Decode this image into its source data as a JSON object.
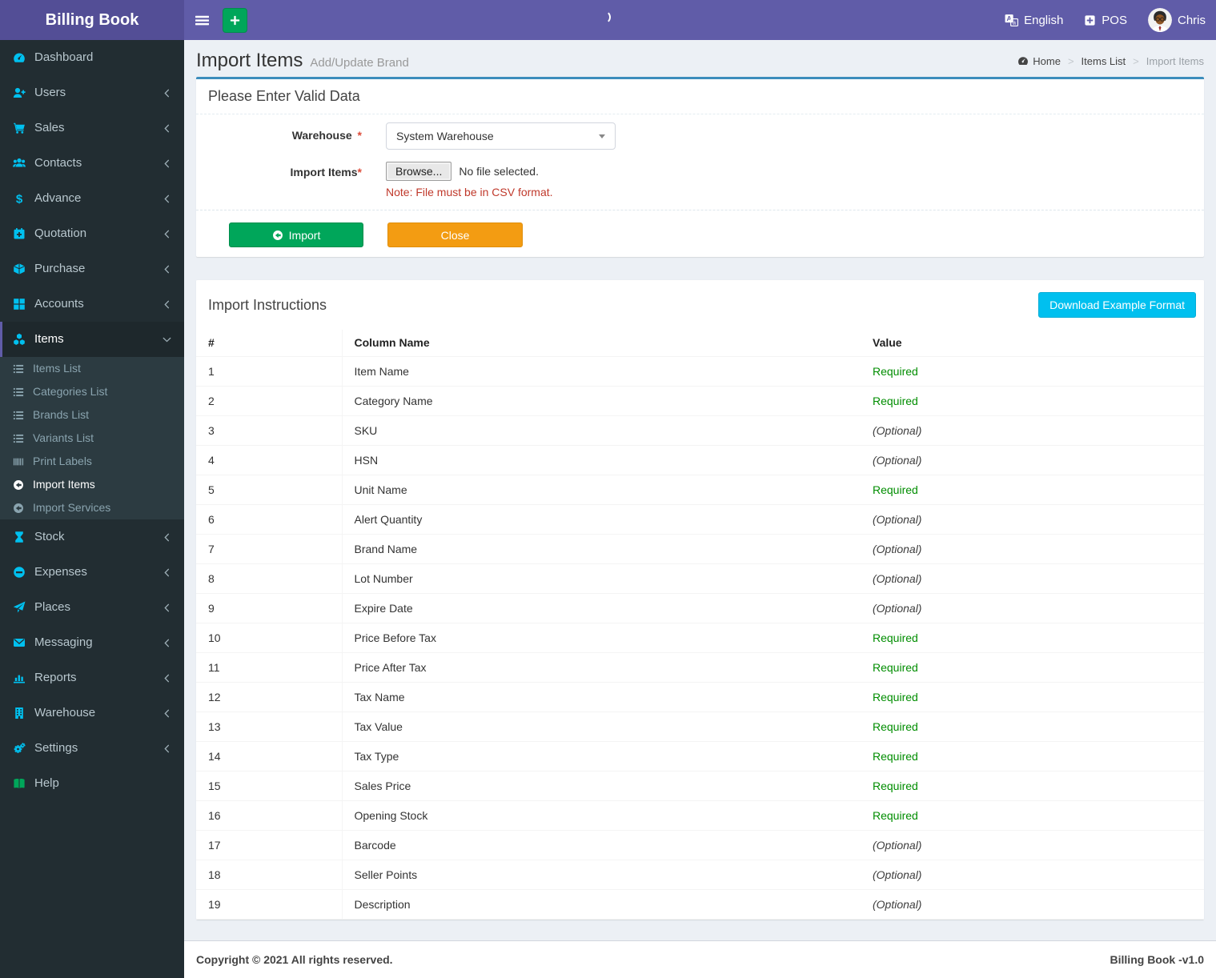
{
  "header": {
    "brand": "Billing Book",
    "language_label": "English",
    "pos_label": "POS",
    "user_name": "Chris"
  },
  "page": {
    "title": "Import Items",
    "subtitle": "Add/Update Brand"
  },
  "breadcrumb": {
    "items": [
      {
        "label": "Home",
        "icon": "gauge-icon",
        "current": false
      },
      {
        "label": "Items List",
        "icon": "",
        "current": false
      },
      {
        "label": "Import Items",
        "icon": "",
        "current": true
      }
    ]
  },
  "sidebar": {
    "items": [
      {
        "label": "Dashboard",
        "icon": "gauge-icon",
        "chevron": ""
      },
      {
        "label": "Users",
        "icon": "user-plus-icon",
        "chevron": "left"
      },
      {
        "label": "Sales",
        "icon": "cart-icon",
        "chevron": "left"
      },
      {
        "label": "Contacts",
        "icon": "users-icon",
        "chevron": "left"
      },
      {
        "label": "Advance",
        "icon": "dollar-icon",
        "chevron": "left"
      },
      {
        "label": "Quotation",
        "icon": "calendar-plus-icon",
        "chevron": "left"
      },
      {
        "label": "Purchase",
        "icon": "cube-icon",
        "chevron": "left"
      },
      {
        "label": "Accounts",
        "icon": "grid-icon",
        "chevron": "left"
      },
      {
        "label": "Items",
        "icon": "cubes-icon",
        "chevron": "down",
        "active": true,
        "submenu": [
          {
            "label": "Items List",
            "icon": "list-icon"
          },
          {
            "label": "Categories List",
            "icon": "list-icon"
          },
          {
            "label": "Brands List",
            "icon": "list-icon"
          },
          {
            "label": "Variants List",
            "icon": "list-icon"
          },
          {
            "label": "Print Labels",
            "icon": "barcode-icon"
          },
          {
            "label": "Import Items",
            "icon": "import-icon",
            "active": true
          },
          {
            "label": "Import Services",
            "icon": "import-icon"
          }
        ]
      },
      {
        "label": "Stock",
        "icon": "hourglass-icon",
        "chevron": "left"
      },
      {
        "label": "Expenses",
        "icon": "minus-circle-icon",
        "chevron": "left"
      },
      {
        "label": "Places",
        "icon": "send-icon",
        "chevron": "left"
      },
      {
        "label": "Messaging",
        "icon": "envelope-icon",
        "chevron": "left"
      },
      {
        "label": "Reports",
        "icon": "chart-icon",
        "chevron": "left"
      },
      {
        "label": "Warehouse",
        "icon": "building-icon",
        "chevron": "left"
      },
      {
        "label": "Settings",
        "icon": "gears-icon",
        "chevron": "left"
      },
      {
        "label": "Help",
        "icon": "book-icon",
        "chevron": "",
        "icon_color": "#00a65a"
      }
    ]
  },
  "form_box": {
    "header": "Please Enter Valid Data",
    "warehouse_label": "Warehouse",
    "required_mark": "*",
    "warehouse_value": "System Warehouse",
    "import_items_label": "Import Items",
    "browse_label": "Browse...",
    "no_file_text": "No file selected.",
    "note": "Note: File must be in CSV format.",
    "import_button": "Import",
    "close_button": "Close"
  },
  "instructions_box": {
    "header": "Import Instructions",
    "download_button": "Download Example Format",
    "table": {
      "columns": [
        "#",
        "Column Name",
        "Value"
      ],
      "rows": [
        {
          "num": "1",
          "name": "Item Name",
          "value": "Required"
        },
        {
          "num": "2",
          "name": "Category Name",
          "value": "Required"
        },
        {
          "num": "3",
          "name": "SKU",
          "value": "(Optional)"
        },
        {
          "num": "4",
          "name": "HSN",
          "value": "(Optional)"
        },
        {
          "num": "5",
          "name": "Unit Name",
          "value": "Required"
        },
        {
          "num": "6",
          "name": "Alert Quantity",
          "value": "(Optional)"
        },
        {
          "num": "7",
          "name": "Brand Name",
          "value": "(Optional)"
        },
        {
          "num": "8",
          "name": "Lot Number",
          "value": "(Optional)"
        },
        {
          "num": "9",
          "name": "Expire Date",
          "value": "(Optional)"
        },
        {
          "num": "10",
          "name": "Price Before Tax",
          "value": "Required"
        },
        {
          "num": "11",
          "name": "Price After Tax",
          "value": "Required"
        },
        {
          "num": "12",
          "name": "Tax Name",
          "value": "Required"
        },
        {
          "num": "13",
          "name": "Tax Value",
          "value": "Required"
        },
        {
          "num": "14",
          "name": "Tax Type",
          "value": "Required"
        },
        {
          "num": "15",
          "name": "Sales Price",
          "value": "Required"
        },
        {
          "num": "16",
          "name": "Opening Stock",
          "value": "Required"
        },
        {
          "num": "17",
          "name": "Barcode",
          "value": "(Optional)"
        },
        {
          "num": "18",
          "name": "Seller Points",
          "value": "(Optional)"
        },
        {
          "num": "19",
          "name": "Description",
          "value": "(Optional)"
        }
      ]
    }
  },
  "footer": {
    "left": "Copyright © 2021 All rights reserved.",
    "right": "Billing Book -v1.0"
  },
  "colors": {
    "navbar": "#605ca8",
    "logo_bg": "#534e96",
    "sidebar_bg": "#222d32",
    "accent_blue": "#3c8dbc",
    "icon_cyan": "#00c0ef",
    "green": "#00a65a",
    "orange": "#f39c12",
    "cyan_button": "#00c0ef",
    "required_green": "#008d00",
    "note_red": "#c0392b"
  }
}
